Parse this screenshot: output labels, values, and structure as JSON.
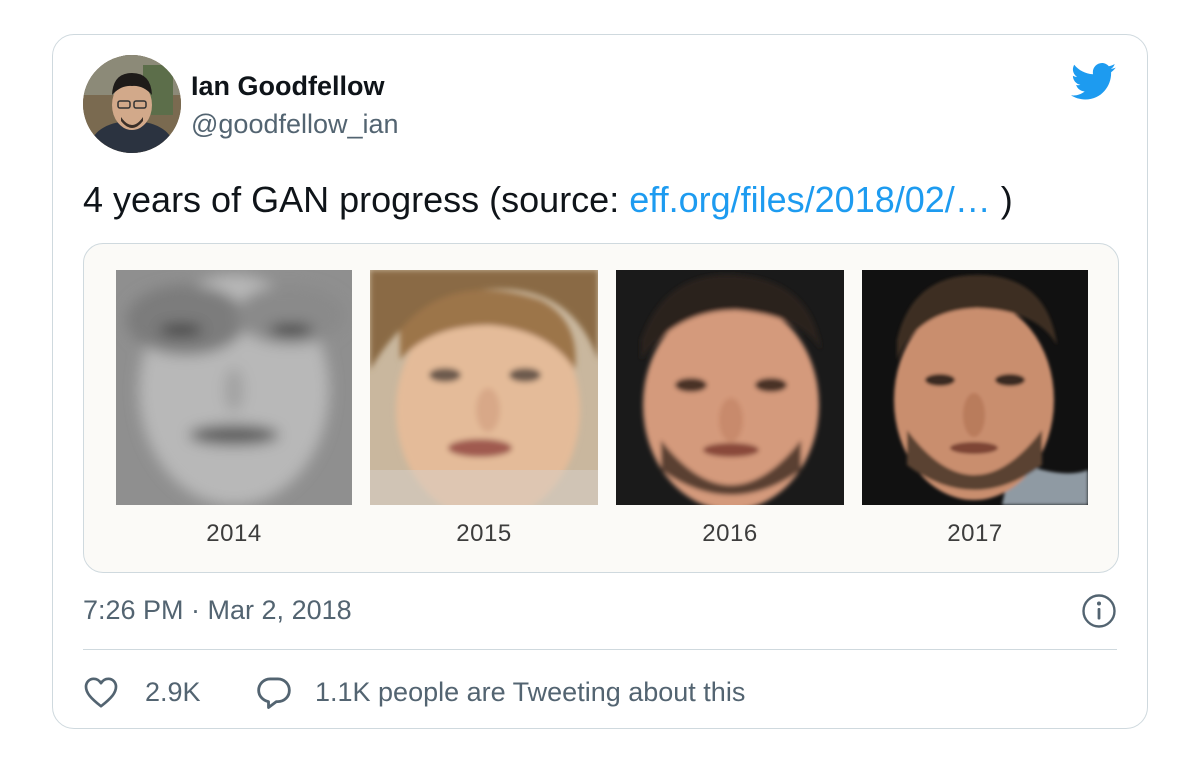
{
  "author": {
    "name": "Ian Goodfellow",
    "handle": "@goodfellow_ian"
  },
  "tweet": {
    "text_prefix": "4 years of GAN progress (source: ",
    "link_text": "eff.org/files/2018/02/…",
    "text_suffix": " )"
  },
  "media": {
    "years": [
      "2014",
      "2015",
      "2016",
      "2017"
    ]
  },
  "timestamp": "7:26 PM · Mar 2, 2018",
  "actions": {
    "like_count": "2.9K",
    "reply_text": "1.1K people are Tweeting about this"
  },
  "colors": {
    "link": "#1d9bf0",
    "brand": "#1d9bf0",
    "secondary_text": "#536471",
    "border": "#cfd9de"
  },
  "icons": [
    "twitter-bird-icon",
    "info-icon",
    "heart-icon",
    "reply-bubble-icon"
  ]
}
